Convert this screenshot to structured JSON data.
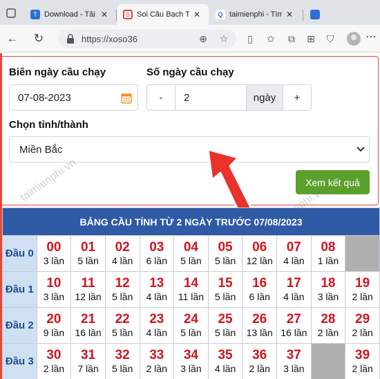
{
  "browser": {
    "tabs": [
      {
        "title": "Download - Tải M",
        "favicon": "T"
      },
      {
        "title": "Soi Cầu Bạch Thủ",
        "favicon": "S"
      },
      {
        "title": "taimienphi - Tìm",
        "favicon": "Q"
      }
    ],
    "url": "https://xoso36"
  },
  "form": {
    "date_label": "Biên ngày cầu chạy",
    "date_value": "07-08-2023",
    "days_label": "Số ngày cầu chạy",
    "minus_label": "-",
    "days_value": "2",
    "days_unit": "ngày",
    "plus_label": "+",
    "province_label": "Chọn tỉnh/thành",
    "province_value": "Miền Bắc",
    "submit_label": "Xem kết quả"
  },
  "watermark": "taimienphi.vn",
  "table": {
    "title": "BẢNG CẦU TÍNH TỪ 2 NGÀY TRƯỚC 07/08/2023",
    "rows": [
      {
        "label": "Đầu 0",
        "cells": [
          {
            "num": "00",
            "count": "3 lần"
          },
          {
            "num": "01",
            "count": "5 lần"
          },
          {
            "num": "02",
            "count": "4 lần"
          },
          {
            "num": "03",
            "count": "6 lần"
          },
          {
            "num": "04",
            "count": "5 lần"
          },
          {
            "num": "05",
            "count": "5 lần"
          },
          {
            "num": "06",
            "count": "12 lần"
          },
          {
            "num": "07",
            "count": "4 lần"
          },
          {
            "num": "08",
            "count": "1 lần"
          },
          null
        ]
      },
      {
        "label": "Đầu 1",
        "cells": [
          {
            "num": "10",
            "count": "3 lần"
          },
          {
            "num": "11",
            "count": "12 lần"
          },
          {
            "num": "12",
            "count": "5 lần"
          },
          {
            "num": "13",
            "count": "4 lần"
          },
          {
            "num": "14",
            "count": "11 lần"
          },
          {
            "num": "15",
            "count": "5 lần"
          },
          {
            "num": "16",
            "count": "6 lần"
          },
          {
            "num": "17",
            "count": "4 lần"
          },
          {
            "num": "18",
            "count": "3 lần"
          },
          {
            "num": "19",
            "count": "2 lần"
          }
        ]
      },
      {
        "label": "Đầu 2",
        "cells": [
          {
            "num": "20",
            "count": "9 lần"
          },
          {
            "num": "21",
            "count": "16 lần"
          },
          {
            "num": "22",
            "count": "5 lần"
          },
          {
            "num": "23",
            "count": "4 lần"
          },
          {
            "num": "24",
            "count": "5 lần"
          },
          {
            "num": "25",
            "count": "5 lần"
          },
          {
            "num": "26",
            "count": "13 lần"
          },
          {
            "num": "27",
            "count": "16 lần"
          },
          {
            "num": "28",
            "count": "2 lần"
          },
          {
            "num": "29",
            "count": "2 lần"
          }
        ]
      },
      {
        "label": "Đầu 3",
        "cells": [
          {
            "num": "30",
            "count": "2 lần"
          },
          {
            "num": "31",
            "count": "7 lần"
          },
          {
            "num": "32",
            "count": "5 lần"
          },
          {
            "num": "33",
            "count": "2 lần"
          },
          {
            "num": "34",
            "count": "3 lần"
          },
          {
            "num": "35",
            "count": "4 lần"
          },
          {
            "num": "36",
            "count": "2 lần"
          },
          {
            "num": "37",
            "count": "3 lần"
          },
          null,
          {
            "num": "39",
            "count": "2 lần"
          }
        ]
      }
    ]
  }
}
